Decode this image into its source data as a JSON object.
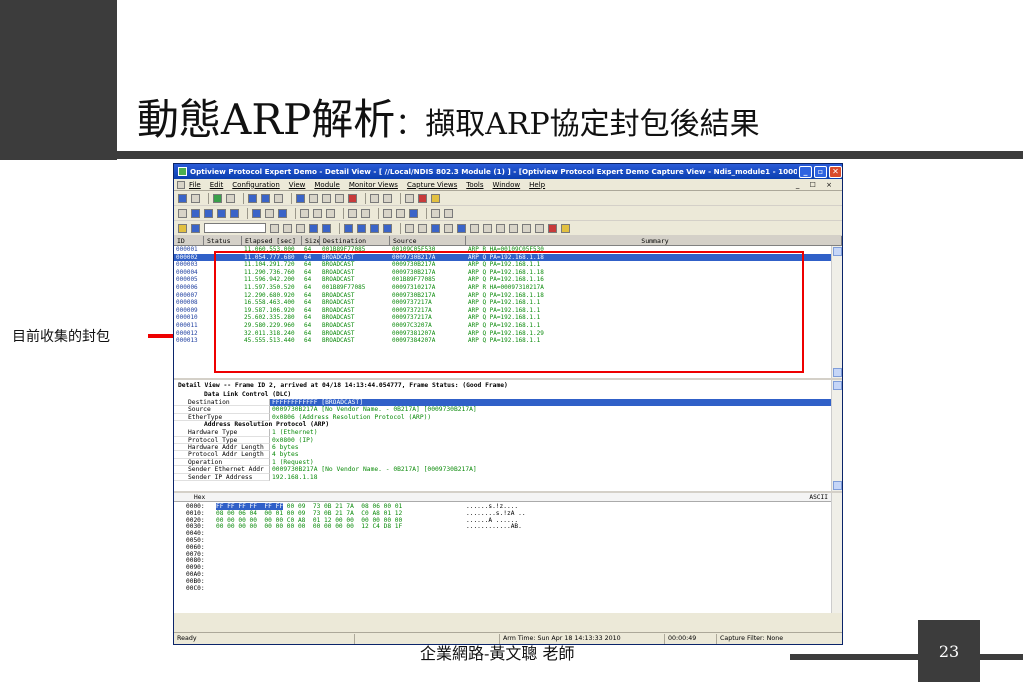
{
  "slide": {
    "title_main": "動態ARP解析",
    "title_sub": "：擷取ARP協定封包後結果",
    "side_label": "目前收集的封包",
    "footer": "企業網路-黃文聰 老師",
    "page_number": "23"
  },
  "window": {
    "title": "Optiview Protocol Expert Demo - Detail View - [ //Local/NDIS 802.3 Module (1) ] - [Optiview Protocol Expert Demo Capture View - Ndis_module1 - 1000MBPS - ...",
    "menu": [
      "File",
      "Edit",
      "Configuration",
      "View",
      "Module",
      "Monitor Views",
      "Capture Views",
      "Tools",
      "Window",
      "Help"
    ],
    "mdi_controls": "_ ☐ ×"
  },
  "list": {
    "columns": [
      "ID",
      "Status",
      "Elapsed [sec]",
      "Size",
      "Destination",
      "Source",
      "Summary"
    ],
    "rows": [
      {
        "id": "000001",
        "status": "",
        "elapsed": "11.060.553.000",
        "size": "64",
        "dest": "001B89F77085",
        "src": "00109C05F530",
        "summary": "ARP  R HA=00109C05F530"
      },
      {
        "id": "000002",
        "status": "",
        "elapsed": "11.054.777.680",
        "size": "64",
        "dest": "BROADCAST",
        "src": "0009730B217A",
        "summary": "ARP  Q PA=192.168.1.18"
      },
      {
        "id": "000003",
        "status": "",
        "elapsed": "11.104.291.720",
        "size": "64",
        "dest": "BROADCAST",
        "src": "0009730B217A",
        "summary": "ARP  Q PA=192.168.1.1"
      },
      {
        "id": "000004",
        "status": "",
        "elapsed": "11.290.736.760",
        "size": "64",
        "dest": "BROADCAST",
        "src": "0009730B217A",
        "summary": "ARP  Q PA=192.168.1.18"
      },
      {
        "id": "000005",
        "status": "",
        "elapsed": "11.596.942.200",
        "size": "64",
        "dest": "BROADCAST",
        "src": "001B89F77085",
        "summary": "ARP  Q PA=192.168.1.16"
      },
      {
        "id": "000006",
        "status": "",
        "elapsed": "11.597.350.520",
        "size": "64",
        "dest": "001B89F77085",
        "src": "00097310217A",
        "summary": "ARP  R HA=00097310217A"
      },
      {
        "id": "000007",
        "status": "",
        "elapsed": "12.290.680.920",
        "size": "64",
        "dest": "BROADCAST",
        "src": "0009730B217A",
        "summary": "ARP  Q PA=192.168.1.18"
      },
      {
        "id": "000008",
        "status": "",
        "elapsed": "16.558.463.400",
        "size": "64",
        "dest": "BROADCAST",
        "src": "0009737217A",
        "summary": "ARP  Q PA=192.168.1.1"
      },
      {
        "id": "000009",
        "status": "",
        "elapsed": "19.587.106.920",
        "size": "64",
        "dest": "BROADCAST",
        "src": "0009737217A",
        "summary": "ARP  Q PA=192.168.1.1"
      },
      {
        "id": "000010",
        "status": "",
        "elapsed": "25.602.335.280",
        "size": "64",
        "dest": "BROADCAST",
        "src": "0009737217A",
        "summary": "ARP  Q PA=192.168.1.1"
      },
      {
        "id": "000011",
        "status": "",
        "elapsed": "29.580.229.960",
        "size": "64",
        "dest": "BROADCAST",
        "src": "00097C3207A",
        "summary": "ARP  Q PA=192.168.1.1"
      },
      {
        "id": "000012",
        "status": "",
        "elapsed": "32.011.318.240",
        "size": "64",
        "dest": "BROADCAST",
        "src": "00097381207A",
        "summary": "ARP  Q PA=192.168.1.29"
      },
      {
        "id": "000013",
        "status": "",
        "elapsed": "45.555.513.440",
        "size": "64",
        "dest": "BROADCAST",
        "src": "00097384207A",
        "summary": "ARP  Q PA=192.168.1.1"
      }
    ],
    "selected_index": 1
  },
  "detail": {
    "header": "Detail View -- Frame ID 2, arrived at 04/18 14:13:44.054777, Frame Status: (Good Frame)",
    "dlc_title": "Data Link Control   (DLC)",
    "dlc_rows": [
      {
        "k": "Destination",
        "v": "FFFFFFFFFFFF    [BROADCAST]",
        "hl": true
      },
      {
        "k": "Source",
        "v": "0009730B217A    [No Vendor Name. - 0B217A]    [0009730B217A]"
      },
      {
        "k": "EtherType",
        "v": "0x0806    (Address Resolution Protocol (ARP))"
      }
    ],
    "arp_title": "Address Resolution Protocol    (ARP)",
    "arp_rows": [
      {
        "k": "Hardware Type",
        "v": "1   (Ethernet)"
      },
      {
        "k": "Protocol Type",
        "v": "0x0800   (IP)"
      },
      {
        "k": "Hardware Addr Length",
        "v": "6 bytes"
      },
      {
        "k": "Protocol Addr Length",
        "v": "4 bytes"
      },
      {
        "k": "Operation",
        "v": "1   (Request)"
      },
      {
        "k": "Sender Ethernet Addr",
        "v": "0009730B217A    [No Vendor Name. - 0B217A]    [0009730B217A]"
      },
      {
        "k": "Sender IP Address",
        "v": "192.168.1.18"
      }
    ]
  },
  "hex": {
    "hex_label": "Hex",
    "ascii_label": "ASCII",
    "offsets": [
      "0000:",
      "0010:",
      "0020:",
      "0030:",
      "0040:",
      "0050:",
      "0060:",
      "0070:",
      "0080:",
      "0090:",
      "00A0:",
      "00B0:",
      "00C0:"
    ],
    "lines": [
      {
        "hl": "FF FF FF FF  FF FF",
        "rest": " 00 09  73 0B 21 7A  08 06 00 01"
      },
      {
        "hl": "",
        "rest": "08 00 06 04  00 01 00 09  73 0B 21 7A  C0 A8 01 12"
      },
      {
        "hl": "",
        "rest": "00 00 00 00  00 00 C0 A8  01 12 00 00  00 00 00 00"
      },
      {
        "hl": "",
        "rest": "00 00 00 00  00 00 00 00  00 00 00 00  12 C4 D8 1F"
      }
    ],
    "ascii": [
      "......s.!z....",
      "........s.!zA ..",
      "......A ......",
      "............AB."
    ]
  },
  "status": {
    "ready": "Ready",
    "arm_time": "Arm Time: Sun Apr 18 14:13:33 2010",
    "elapsed": "00:00:49",
    "filter": "Capture Filter: None"
  }
}
